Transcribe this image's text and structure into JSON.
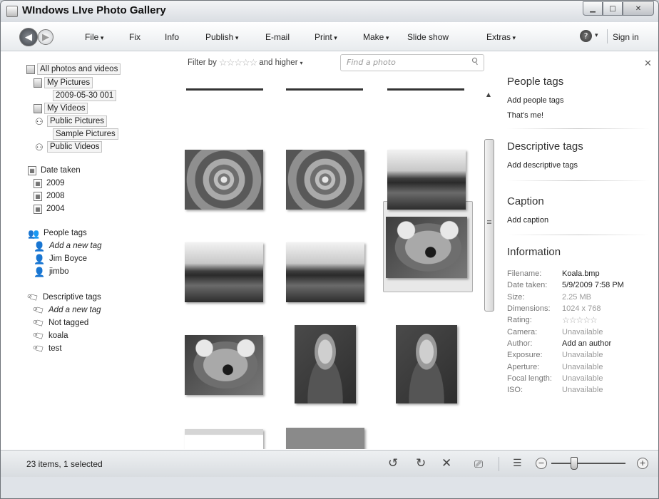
{
  "window": {
    "title": "WIndows LIve Photo Gallery"
  },
  "toolbar": {
    "menus": [
      {
        "label": "File",
        "arrow": true
      },
      {
        "label": "Fix",
        "arrow": false
      },
      {
        "label": "Info",
        "arrow": false
      },
      {
        "label": "Publish",
        "arrow": true
      },
      {
        "label": "E-mail",
        "arrow": false
      },
      {
        "label": "Print",
        "arrow": true
      },
      {
        "label": "Make",
        "arrow": true
      },
      {
        "label": "Slide show",
        "arrow": false
      },
      {
        "label": "Extras",
        "arrow": true
      }
    ],
    "sign_in": "Sign in"
  },
  "sidebar": {
    "all_photos": "All photos and videos",
    "my_pictures": "My Pictures",
    "folder_2009": "2009-05-30 001",
    "my_videos": "My Videos",
    "public_pictures": "Public Pictures",
    "sample_pictures": "Sample Pictures",
    "public_videos": "Public Videos",
    "date_taken": "Date taken",
    "years": [
      "2009",
      "2008",
      "2004"
    ],
    "people_tags": "People tags",
    "people": [
      "Add a new tag",
      "Jim Boyce",
      "jimbo"
    ],
    "descriptive_tags": "Descriptive tags",
    "tags": [
      "Add a new tag",
      "Not tagged",
      "koala",
      "test"
    ]
  },
  "filter": {
    "prefix": "Filter by",
    "stars": "☆☆☆☆☆",
    "suffix": "and higher",
    "search_placeholder": "Find a photo"
  },
  "thumbnails": [
    {
      "subject": "flower"
    },
    {
      "subject": "flower"
    },
    {
      "subject": "desert"
    },
    {
      "subject": "desert"
    },
    {
      "subject": "desert"
    },
    {
      "subject": "koala"
    },
    {
      "subject": "koala"
    },
    {
      "subject": "portrait"
    },
    {
      "subject": "portrait"
    },
    {
      "subject": "screenshot"
    },
    {
      "subject": "group"
    }
  ],
  "info_pane": {
    "people_tags_title": "People tags",
    "add_people_tags": "Add people tags",
    "thats_me": "That's me!",
    "descriptive_tags_title": "Descriptive tags",
    "add_descriptive_tags": "Add descriptive tags",
    "caption_title": "Caption",
    "add_caption": "Add caption",
    "information_title": "Information",
    "fields": [
      {
        "key": "Filename:",
        "value": "Koala.bmp",
        "style": "dark"
      },
      {
        "key": "Date taken:",
        "value": "5/9/2009 7:58 PM",
        "style": "dark"
      },
      {
        "key": "Size:",
        "value": "2.25 MB",
        "style": "muted"
      },
      {
        "key": "Dimensions:",
        "value": "1024 x 768",
        "style": "muted"
      },
      {
        "key": "Rating:",
        "value": "☆☆☆☆☆",
        "style": "stars"
      },
      {
        "key": "Camera:",
        "value": "Unavailable",
        "style": "muted"
      },
      {
        "key": "Author:",
        "value": "Add an author",
        "style": "dark"
      },
      {
        "key": "Exposure:",
        "value": "Unavailable",
        "style": "muted"
      },
      {
        "key": "Aperture:",
        "value": "Unavailable",
        "style": "muted"
      },
      {
        "key": "Focal length:",
        "value": "Unavailable",
        "style": "muted"
      },
      {
        "key": "ISO:",
        "value": "Unavailable",
        "style": "muted"
      }
    ]
  },
  "status": {
    "text": "23 items, 1 selected",
    "zoom_level": 0.3
  }
}
